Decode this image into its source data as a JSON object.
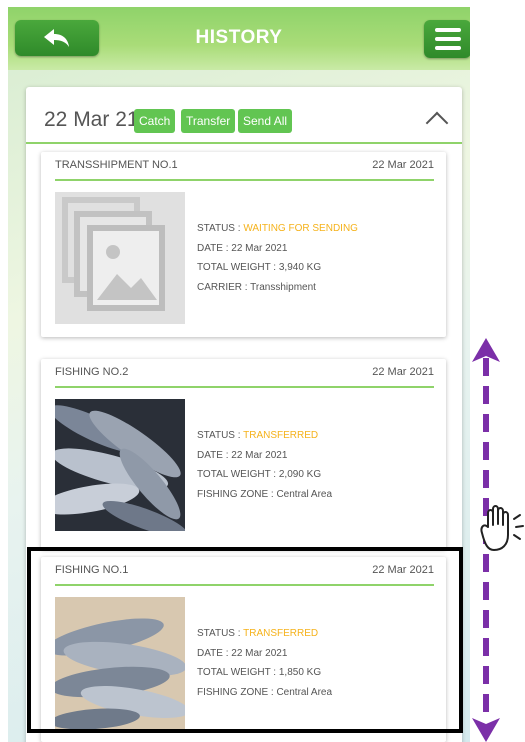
{
  "header": {
    "title": "HISTORY"
  },
  "group": {
    "date": "22 Mar 21",
    "actions": [
      "Catch",
      "Transfer",
      "Send All"
    ]
  },
  "items": [
    {
      "name": "TRANSSHIPMENT NO.1",
      "date": "22 Mar 2021",
      "status_label": "STATUS : ",
      "status_value": "WAITING FOR SENDING",
      "date_line": "DATE : 22 Mar 2021",
      "weight_line": "TOTAL WEIGHT : 3,940 KG",
      "extra_line": "CARRIER : Transshipment",
      "image": "placeholder-photo-icon"
    },
    {
      "name": "FISHING NO.2",
      "date": "22 Mar 2021",
      "status_label": "STATUS : ",
      "status_value": "TRANSFERRED",
      "date_line": "DATE : 22 Mar 2021",
      "weight_line": "TOTAL WEIGHT : 2,090 KG",
      "extra_line": "FISHING ZONE : Central Area",
      "image": "fish-catch-photo"
    },
    {
      "name": "FISHING NO.1",
      "date": "22 Mar 2021",
      "status_label": "STATUS : ",
      "status_value": "TRANSFERRED",
      "date_line": "DATE : 22 Mar 2021",
      "weight_line": "TOTAL WEIGHT : 1,850 KG",
      "extra_line": "FISHING ZONE : Central Area",
      "image": "fish-catch-photo"
    }
  ],
  "colors": {
    "accent_green": "#62c552",
    "status_orange": "#f5b21b",
    "scroll_arrow_purple": "#7b2fa8"
  }
}
